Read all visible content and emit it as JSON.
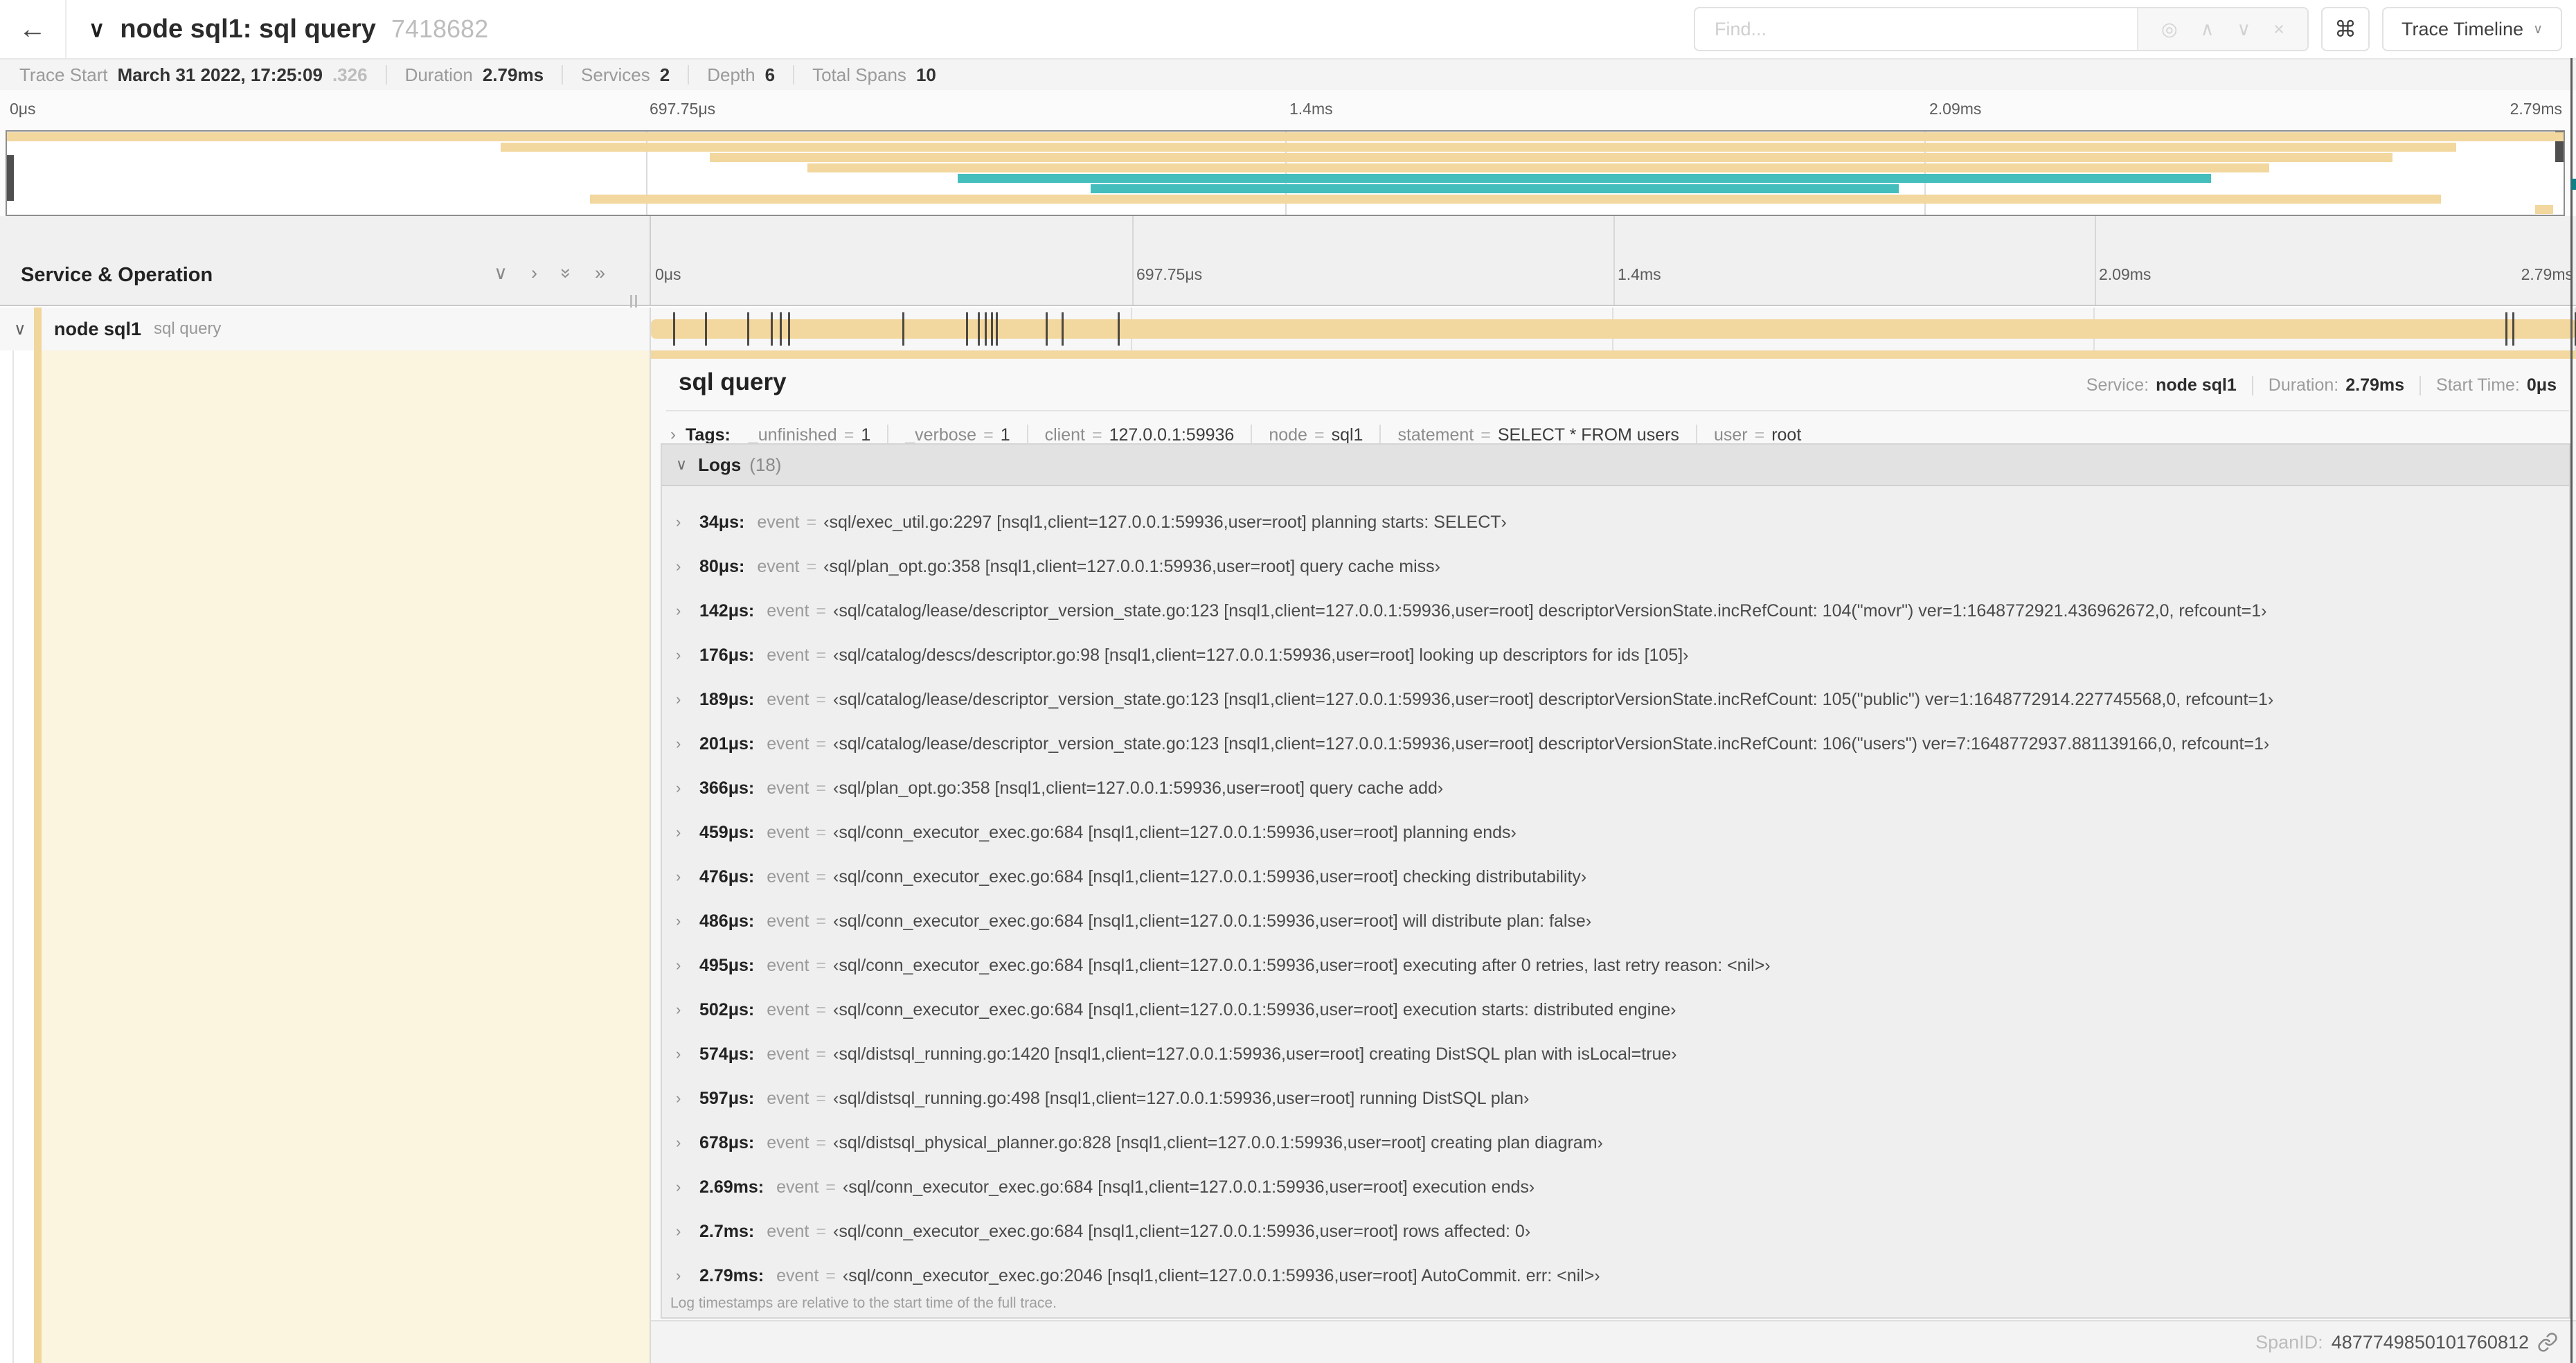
{
  "colors": {
    "tan": "#F2D79E",
    "teal": "#43BEBD",
    "cream": "#FBF4DF",
    "accent": "#F1D69B",
    "edge_teal": "#0E7F86"
  },
  "header": {
    "back_icon": "←",
    "collapse_icon": "∨",
    "title": "node sql1: sql query",
    "trace_id": "7418682",
    "find": {
      "placeholder": "Find...",
      "target_icon": "◎",
      "prev_icon": "∧",
      "next_icon": "∨",
      "clear_icon": "×"
    },
    "shortcut_icon": "⌘",
    "view_button": {
      "label": "Trace Timeline",
      "chevron": "∨"
    }
  },
  "trace_meta": {
    "items": [
      {
        "label": "Trace Start",
        "value": "March 31 2022, 17:25:09",
        "suffix": ".326"
      },
      {
        "label": "Duration",
        "value": "2.79ms",
        "suffix": ""
      },
      {
        "label": "Services",
        "value": "2",
        "suffix": ""
      },
      {
        "label": "Depth",
        "value": "6",
        "suffix": ""
      },
      {
        "label": "Total Spans",
        "value": "10",
        "suffix": ""
      }
    ]
  },
  "minimap": {
    "ticks": [
      {
        "label": "0μs",
        "pct": 0
      },
      {
        "label": "697.75μs",
        "pct": 25
      },
      {
        "label": "1.4ms",
        "pct": 50
      },
      {
        "label": "2.09ms",
        "pct": 75
      },
      {
        "label": "2.79ms",
        "pct": 100
      }
    ],
    "spans": [
      {
        "row": 0,
        "start": 0,
        "end": 100,
        "color": "tan"
      },
      {
        "row": 1,
        "start": 19.3,
        "end": 95.8,
        "color": "tan"
      },
      {
        "row": 2,
        "start": 27.5,
        "end": 93.3,
        "color": "tan"
      },
      {
        "row": 3,
        "start": 31.3,
        "end": 88.5,
        "color": "tan"
      },
      {
        "row": 4,
        "start": 37.2,
        "end": 86.2,
        "color": "teal"
      },
      {
        "row": 5,
        "start": 42.4,
        "end": 74.0,
        "color": "teal"
      },
      {
        "row": 6,
        "start": 22.8,
        "end": 95.2,
        "color": "tan"
      },
      {
        "row": 7,
        "start": 98.9,
        "end": 99.6,
        "color": "tan"
      }
    ]
  },
  "timeline": {
    "header_label": "Service & Operation",
    "controls": [
      {
        "name": "collapse-one",
        "glyph": "∨",
        "rotate": false
      },
      {
        "name": "expand-one",
        "glyph": "›",
        "rotate": false
      },
      {
        "name": "collapse-all",
        "glyph": "»",
        "rotate": true
      },
      {
        "name": "expand-all",
        "glyph": "»",
        "rotate": false
      }
    ],
    "row": {
      "expander": "∨",
      "service": "node sql1",
      "operation": "sql query",
      "bar_start_pct": 0,
      "bar_end_pct": 100,
      "total_us": 2790,
      "marker_times_us": [
        34,
        80,
        142,
        176,
        189,
        201,
        366,
        459,
        476,
        486,
        495,
        502,
        574,
        597,
        678,
        2690,
        2700,
        2790
      ]
    }
  },
  "detail": {
    "title": "sql query",
    "meta": [
      {
        "label": "Service:",
        "value": "node sql1"
      },
      {
        "label": "Duration:",
        "value": "2.79ms"
      },
      {
        "label": "Start Time:",
        "value": "0μs"
      }
    ],
    "tags": {
      "chevron": "›",
      "label": "Tags:",
      "items": [
        {
          "key": "_unfinished",
          "value": "1"
        },
        {
          "key": "_verbose",
          "value": "1"
        },
        {
          "key": "client",
          "value": "127.0.0.1:59936"
        },
        {
          "key": "node",
          "value": "sql1"
        },
        {
          "key": "statement",
          "value": "SELECT * FROM users"
        },
        {
          "key": "user",
          "value": "root"
        }
      ]
    },
    "logs": {
      "chevron": "∨",
      "label": "Logs",
      "count": "(18)",
      "row_chevron": "›",
      "field_key": "event",
      "entries": [
        {
          "time": "34μs:",
          "value": "‹sql/exec_util.go:2297 [nsql1,client=127.0.0.1:59936,user=root] planning starts: SELECT›"
        },
        {
          "time": "80μs:",
          "value": "‹sql/plan_opt.go:358 [nsql1,client=127.0.0.1:59936,user=root] query cache miss›"
        },
        {
          "time": "142μs:",
          "value": "‹sql/catalog/lease/descriptor_version_state.go:123 [nsql1,client=127.0.0.1:59936,user=root] descriptorVersionState.incRefCount: 104(\"movr\") ver=1:1648772921.436962672,0, refcount=1›"
        },
        {
          "time": "176μs:",
          "value": "‹sql/catalog/descs/descriptor.go:98 [nsql1,client=127.0.0.1:59936,user=root] looking up descriptors for ids [105]›"
        },
        {
          "time": "189μs:",
          "value": "‹sql/catalog/lease/descriptor_version_state.go:123 [nsql1,client=127.0.0.1:59936,user=root] descriptorVersionState.incRefCount: 105(\"public\") ver=1:1648772914.227745568,0, refcount=1›"
        },
        {
          "time": "201μs:",
          "value": "‹sql/catalog/lease/descriptor_version_state.go:123 [nsql1,client=127.0.0.1:59936,user=root] descriptorVersionState.incRefCount: 106(\"users\") ver=7:1648772937.881139166,0, refcount=1›"
        },
        {
          "time": "366μs:",
          "value": "‹sql/plan_opt.go:358 [nsql1,client=127.0.0.1:59936,user=root] query cache add›"
        },
        {
          "time": "459μs:",
          "value": "‹sql/conn_executor_exec.go:684 [nsql1,client=127.0.0.1:59936,user=root] planning ends›"
        },
        {
          "time": "476μs:",
          "value": "‹sql/conn_executor_exec.go:684 [nsql1,client=127.0.0.1:59936,user=root] checking distributability›"
        },
        {
          "time": "486μs:",
          "value": "‹sql/conn_executor_exec.go:684 [nsql1,client=127.0.0.1:59936,user=root] will distribute plan: false›"
        },
        {
          "time": "495μs:",
          "value": "‹sql/conn_executor_exec.go:684 [nsql1,client=127.0.0.1:59936,user=root] executing after 0 retries, last retry reason: <nil>›"
        },
        {
          "time": "502μs:",
          "value": "‹sql/conn_executor_exec.go:684 [nsql1,client=127.0.0.1:59936,user=root] execution starts: distributed engine›"
        },
        {
          "time": "574μs:",
          "value": "‹sql/distsql_running.go:1420 [nsql1,client=127.0.0.1:59936,user=root] creating DistSQL plan with isLocal=true›"
        },
        {
          "time": "597μs:",
          "value": "‹sql/distsql_running.go:498 [nsql1,client=127.0.0.1:59936,user=root] running DistSQL plan›"
        },
        {
          "time": "678μs:",
          "value": "‹sql/distsql_physical_planner.go:828 [nsql1,client=127.0.0.1:59936,user=root] creating plan diagram›"
        },
        {
          "time": "2.69ms:",
          "value": "‹sql/conn_executor_exec.go:684 [nsql1,client=127.0.0.1:59936,user=root] execution ends›"
        },
        {
          "time": "2.7ms:",
          "value": "‹sql/conn_executor_exec.go:684 [nsql1,client=127.0.0.1:59936,user=root] rows affected: 0›"
        },
        {
          "time": "2.79ms:",
          "value": "‹sql/conn_executor_exec.go:2046 [nsql1,client=127.0.0.1:59936,user=root] AutoCommit. err: <nil>›"
        }
      ],
      "footnote": "Log timestamps are relative to the start time of the full trace."
    },
    "footer": {
      "label": "SpanID:",
      "value": "4877749850101760812"
    }
  }
}
